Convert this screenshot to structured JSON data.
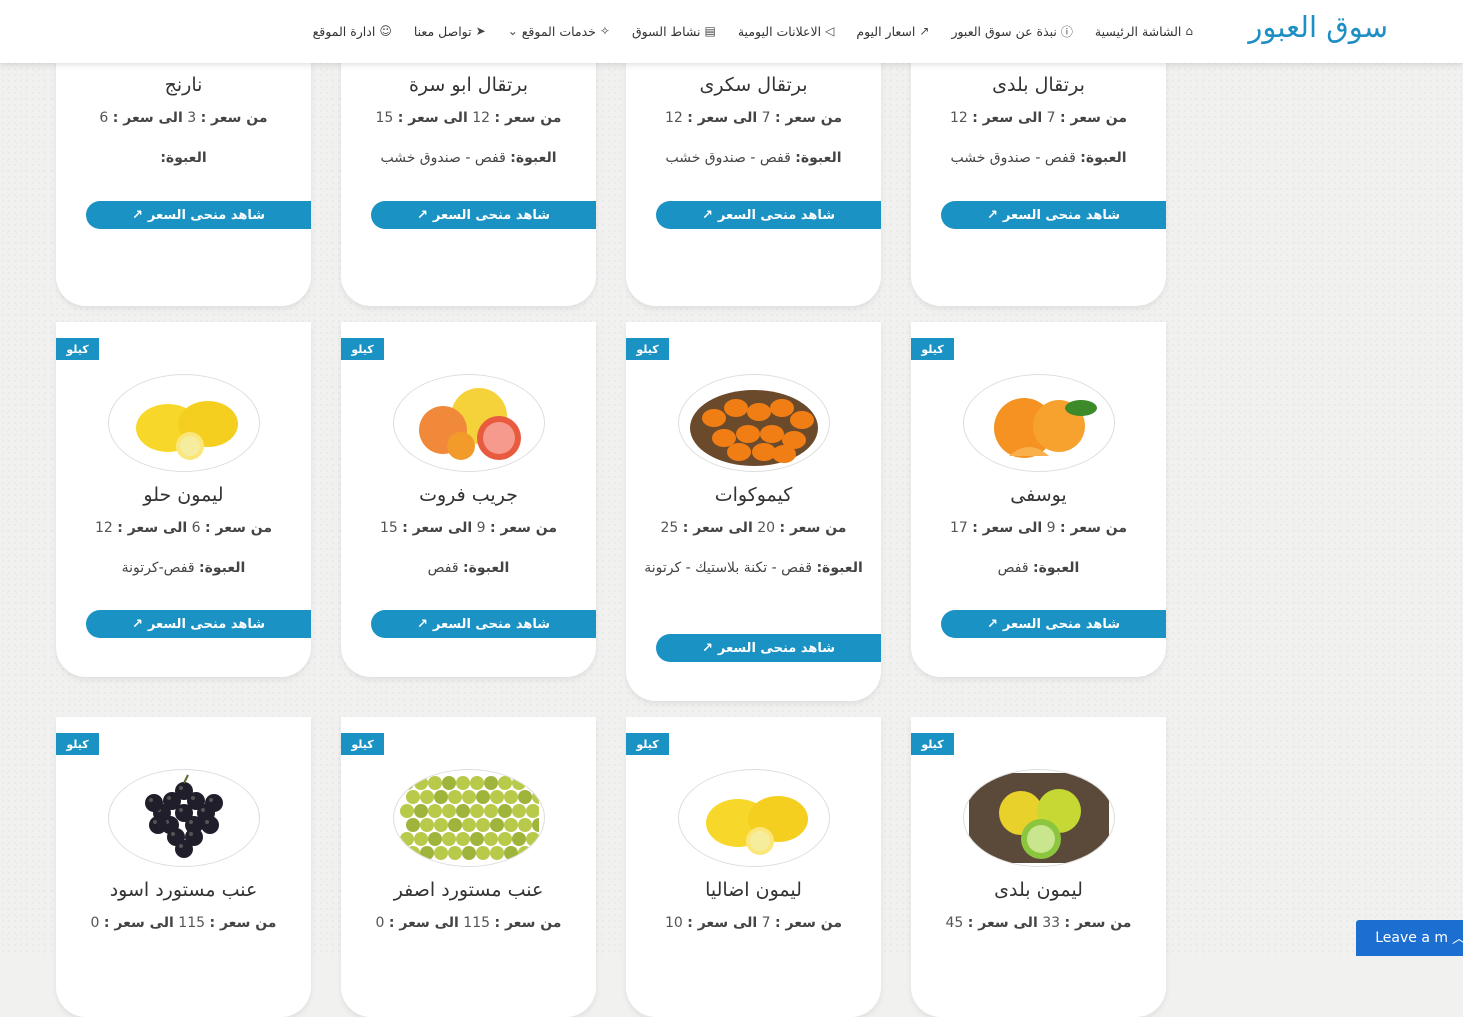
{
  "navbar": {
    "brand": "سوق العبور",
    "links": [
      {
        "label": "الشاشة الرئيسية",
        "icon": "home-icon"
      },
      {
        "label": "نبذة عن سوق العبور",
        "icon": "info-icon"
      },
      {
        "label": "اسعار اليوم",
        "icon": "chart-icon"
      },
      {
        "label": "الاعلانات اليومية",
        "icon": "megaphone-icon"
      },
      {
        "label": "نشاط السوق",
        "icon": "newspaper-icon"
      },
      {
        "label": "خدمات الموقع",
        "icon": "handshake-icon",
        "chevron": "chevron-down-icon"
      },
      {
        "label": "تواصل معنا",
        "icon": "paper-plane-icon"
      },
      {
        "label": "ادارة الموقع",
        "icon": "user-icon"
      }
    ]
  },
  "labels": {
    "from_price": "من سعر :",
    "to_price": "الى سعر :",
    "pack": "العبوة:",
    "chart_button": "شاهد منحى السعر",
    "unit_badge": "كيلو"
  },
  "products": [
    {
      "name": "برتقال بلدى",
      "min": "7",
      "max": "12",
      "pack": "قفص - صندوق خشب",
      "fruit": "orange"
    },
    {
      "name": "برتقال سكرى",
      "min": "7",
      "max": "12",
      "pack": "قفص - صندوق خشب",
      "fruit": "orange"
    },
    {
      "name": "برتقال ابو سرة",
      "min": "12",
      "max": "15",
      "pack": "قفص - صندوق خشب",
      "fruit": "orange"
    },
    {
      "name": "نارنج",
      "min": "3",
      "max": "6",
      "pack": "",
      "fruit": "grapefruit"
    },
    {
      "name": "يوسفى",
      "min": "9",
      "max": "17",
      "pack": "قفص",
      "fruit": "tangerine",
      "unit": "كيلو"
    },
    {
      "name": "كيموكوات",
      "min": "20",
      "max": "25",
      "pack": "قفص - تكنة بلاستيك - كرتونة",
      "fruit": "kumquat",
      "unit": "كيلو"
    },
    {
      "name": "جريب فروت",
      "min": "9",
      "max": "15",
      "pack": "قفص",
      "fruit": "grapefruit",
      "unit": "كيلو"
    },
    {
      "name": "ليمون حلو",
      "min": "6",
      "max": "12",
      "pack": "قفص-كرتونة",
      "fruit": "lemon",
      "unit": "كيلو"
    },
    {
      "name": "ليمون بلدى",
      "min": "33",
      "max": "45",
      "pack": "",
      "fruit": "lime",
      "unit": "كيلو"
    },
    {
      "name": "ليمون اضاليا",
      "min": "7",
      "max": "10",
      "pack": "",
      "fruit": "lemon",
      "unit": "كيلو"
    },
    {
      "name": "عنب مستورد اصفر",
      "min": "115",
      "max": "0",
      "pack": "",
      "fruit": "green-grape",
      "unit": "كيلو"
    },
    {
      "name": "عنب مستورد اسود",
      "min": "115",
      "max": "0",
      "pack": "",
      "fruit": "black-grape",
      "unit": "كيلو"
    }
  ],
  "chat_widget": {
    "label": "Leave a m",
    "icon": "chevron-up-icon"
  },
  "colors": {
    "accent": "#1a93c4",
    "brand": "#1e8fc4",
    "chat": "#1c6fd1"
  }
}
